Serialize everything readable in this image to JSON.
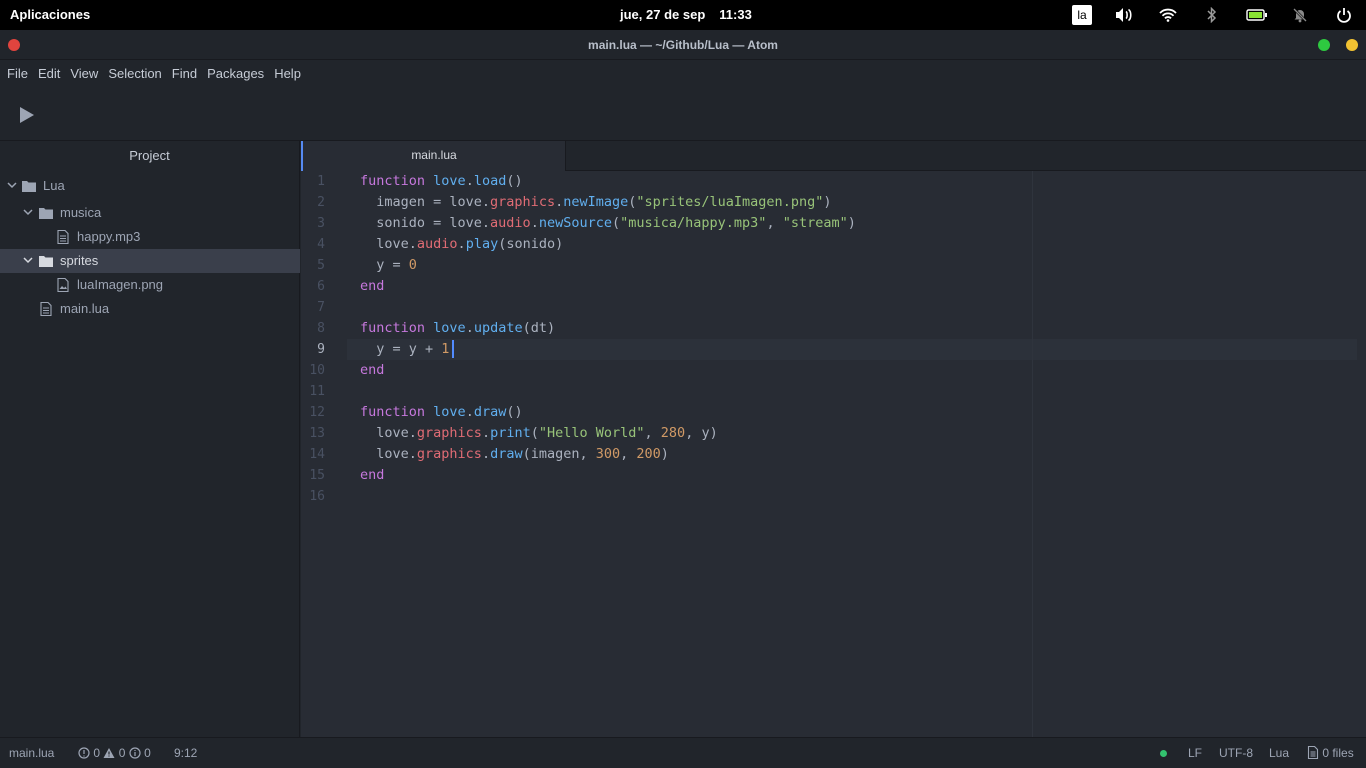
{
  "system_bar": {
    "apps_label": "Aplicaciones",
    "date": "jue, 27 de sep",
    "time": "11:33",
    "keyboard_layout": "la",
    "icons": [
      "volume-icon",
      "wifi-icon",
      "bluetooth-icon",
      "battery-icon",
      "notifications-off-icon",
      "power-icon"
    ]
  },
  "window": {
    "title": "main.lua — ~/Github/Lua — Atom",
    "buttons": {
      "close_color": "#e0443e",
      "maximize_color": "#2ec940",
      "minimize_color": "#f1c232"
    }
  },
  "menu": {
    "items": [
      "File",
      "Edit",
      "View",
      "Selection",
      "Find",
      "Packages",
      "Help"
    ]
  },
  "toolbar": {
    "run_icon": "play-icon"
  },
  "tree": {
    "header": "Project",
    "items": [
      {
        "label": "Lua",
        "type": "folder",
        "expanded": true
      },
      {
        "label": "musica",
        "type": "folder",
        "expanded": true
      },
      {
        "label": "happy.mp3",
        "type": "file"
      },
      {
        "label": "sprites",
        "type": "folder",
        "expanded": true,
        "selected": true
      },
      {
        "label": "luaImagen.png",
        "type": "image"
      },
      {
        "label": "main.lua",
        "type": "file"
      }
    ]
  },
  "tabs": [
    {
      "label": "main.lua",
      "active": true
    }
  ],
  "editor": {
    "line_numbers": [
      "1",
      "2",
      "3",
      "4",
      "5",
      "6",
      "7",
      "8",
      "9",
      "10",
      "11",
      "12",
      "13",
      "14",
      "15",
      "16"
    ],
    "current_line": 9,
    "strings": {
      "img_path": "\"sprites/luaImagen.png\"",
      "music_path": "\"musica/happy.mp3\"",
      "stream": "\"stream\"",
      "hello": "\"Hello World\""
    },
    "numbers": {
      "y0": "0",
      "inc": "1",
      "x1": "280",
      "x2": "300",
      "y2": "200"
    }
  },
  "status": {
    "file": "main.lua",
    "errors": "0",
    "warnings": "0",
    "infos": "0",
    "cursor_pos": "9:12",
    "line_ending": "LF",
    "encoding": "UTF-8",
    "grammar": "Lua",
    "files_label": "0 files",
    "git_dot_color": "#33c26f"
  }
}
